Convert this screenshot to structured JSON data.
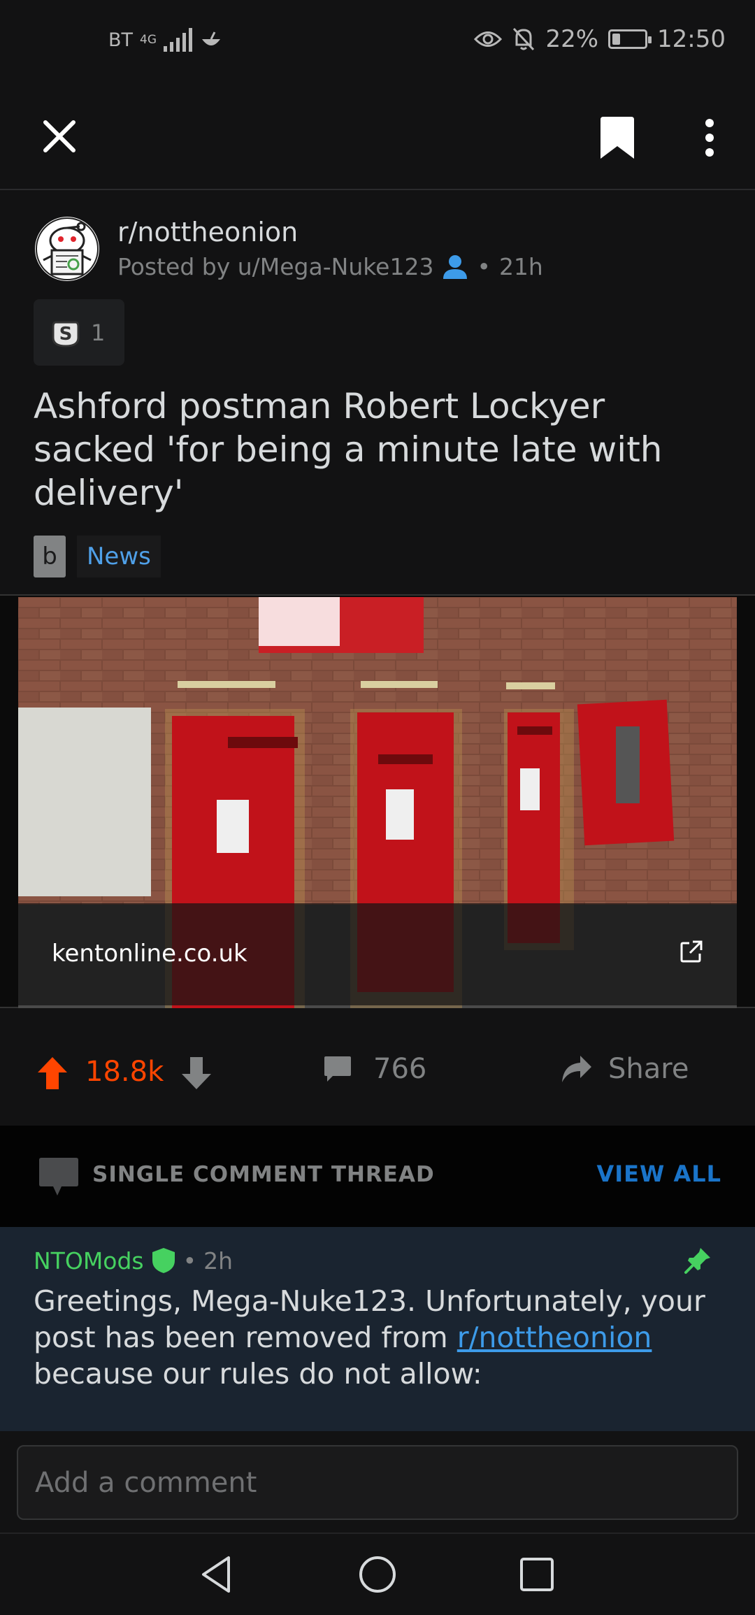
{
  "status_bar": {
    "carrier": "BT",
    "network": "4G",
    "battery": "22%",
    "time": "12:50"
  },
  "top_bar": {
    "close_icon": "close-icon",
    "save_icon": "bookmark-icon",
    "more_icon": "more-vertical-icon"
  },
  "post": {
    "subreddit": "r/nottheonion",
    "posted_by": "Posted by u/Mega-Nuke123",
    "age": "21h",
    "award_count": "1",
    "title": "Ashford postman Robert Lockyer sacked 'for being a minute late with delivery'",
    "flair_letter": "b",
    "flair": "News",
    "link_domain": "kentonline.co.uk"
  },
  "actions": {
    "score": "18.8k",
    "comments": "766",
    "share": "Share"
  },
  "thread": {
    "label": "SINGLE COMMENT THREAD",
    "view_all": "VIEW ALL"
  },
  "comment": {
    "author": "NTOMods",
    "age": "2h",
    "body_before": "Greetings, Mega-Nuke123. Unfortunately, your post has been removed from ",
    "body_link": "r/nottheonion",
    "body_after": " because our rules do not allow:"
  },
  "composer": {
    "placeholder": "Add a comment"
  },
  "colors": {
    "upvote": "#ff4500",
    "mod_green": "#46d160",
    "link_blue": "#3d9be9",
    "flair_blue": "#4fa0e8"
  }
}
